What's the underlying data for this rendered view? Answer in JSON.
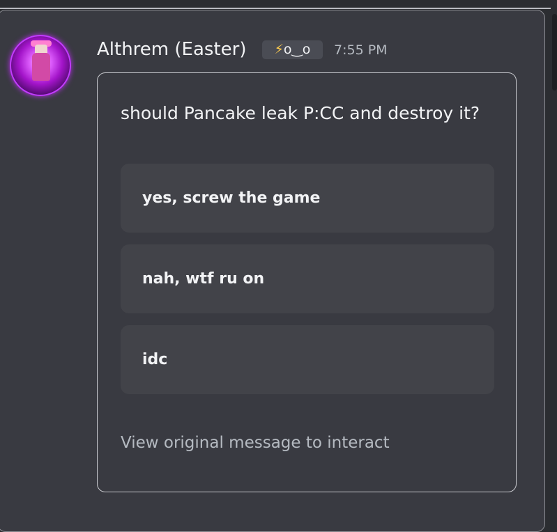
{
  "message": {
    "author": "Althrem (Easter)",
    "tag": {
      "icon": "lightning-bolt-icon",
      "text": "o‿o",
      "bolt_glyph": "⚡"
    },
    "timestamp": "7:55 PM"
  },
  "poll": {
    "question": "should Pancake leak P:CC and destroy it?",
    "options": [
      {
        "label": "yes, screw the game"
      },
      {
        "label": "nah, wtf ru on"
      },
      {
        "label": "idc"
      }
    ],
    "footer": "View original message to interact"
  },
  "colors": {
    "background": "#393a41",
    "option_background": "#424349",
    "text_primary": "#f2f3f5",
    "text_muted": "#b5bac1",
    "bolt": "#ffcc4d"
  }
}
